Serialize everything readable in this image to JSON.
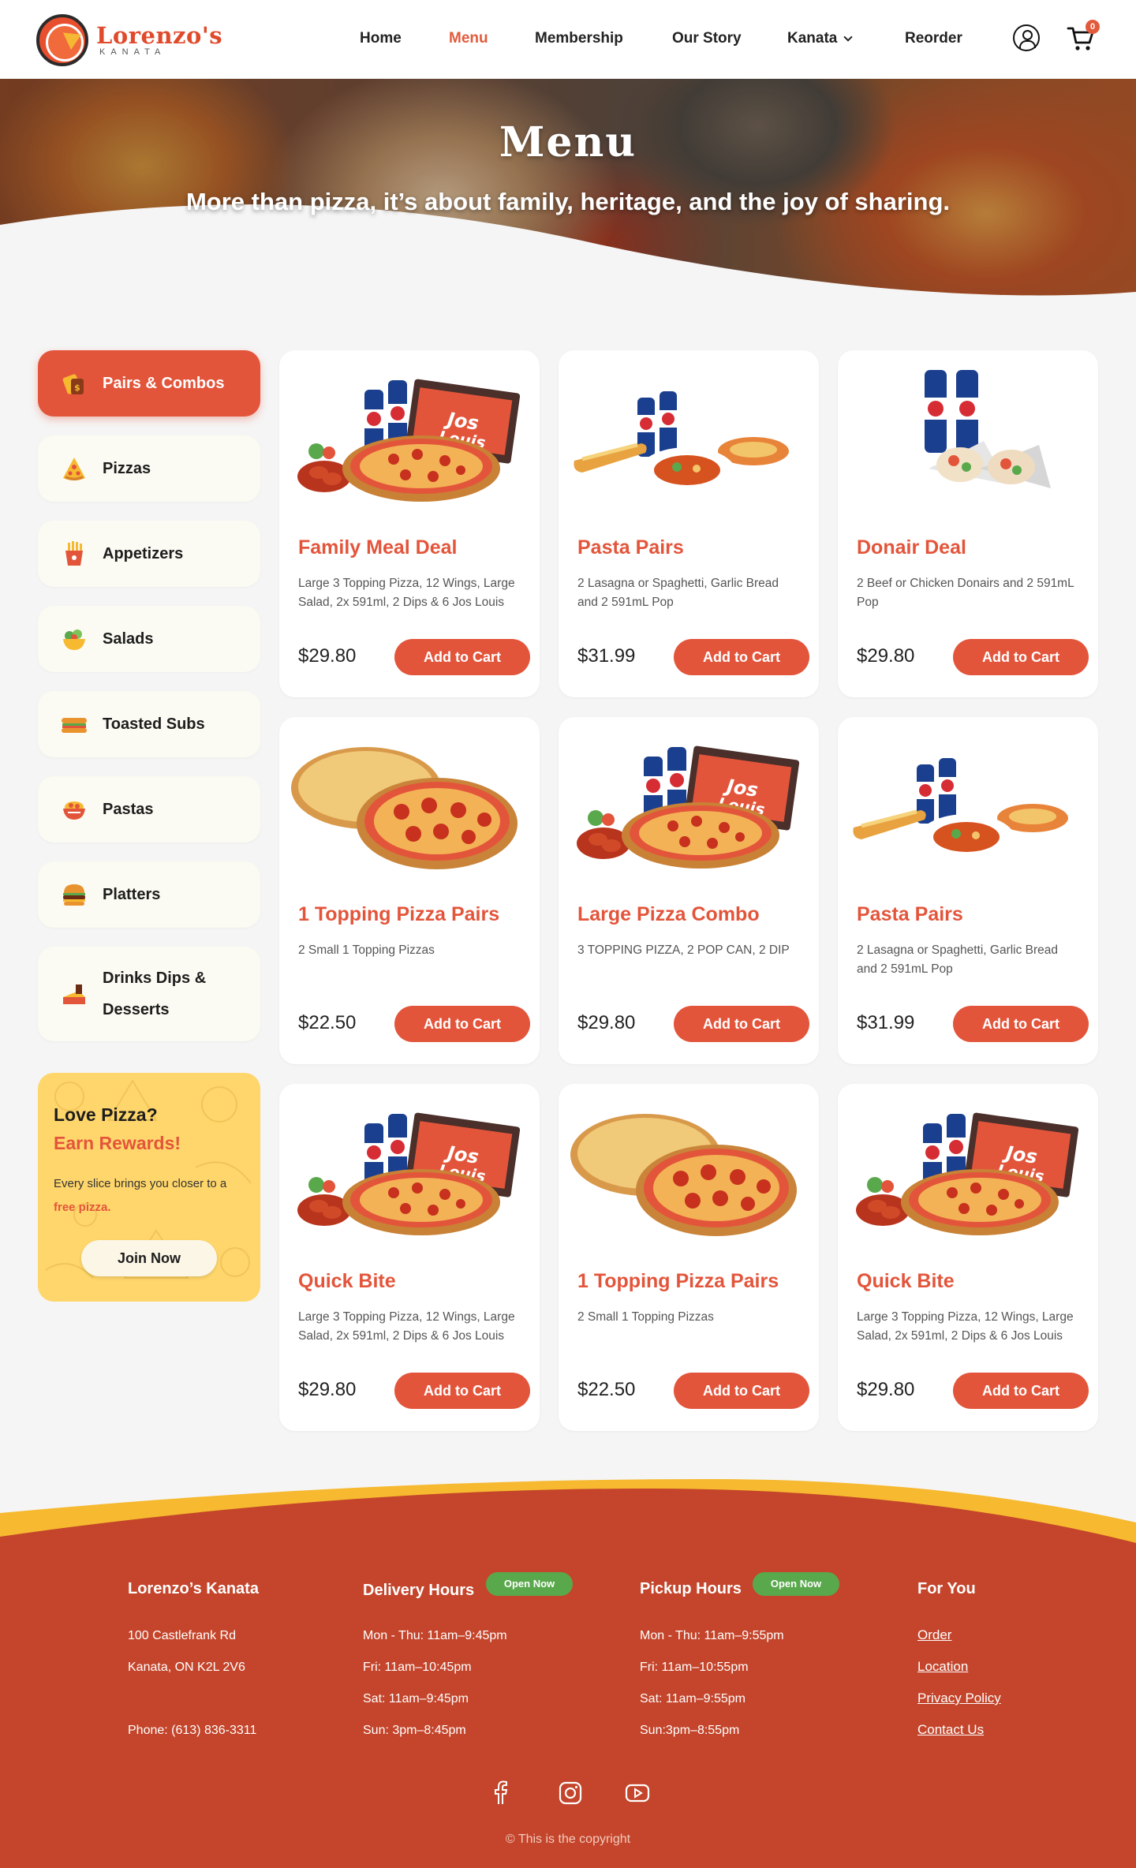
{
  "brand": {
    "name": "Lorenzo's",
    "sub": "KANATA"
  },
  "nav": {
    "home": "Home",
    "menu": "Menu",
    "membership": "Membership",
    "story": "Our Story",
    "location": "Kanata",
    "reorder": "Reorder",
    "cart_count": "0"
  },
  "hero": {
    "title": "Menu",
    "subtitle": "More than pizza, it’s about family, heritage, and the joy of sharing."
  },
  "categories": [
    {
      "label": "Pairs & Combos",
      "active": true
    },
    {
      "label": "Pizzas"
    },
    {
      "label": "Appetizers"
    },
    {
      "label": "Salads"
    },
    {
      "label": "Toasted Subs"
    },
    {
      "label": "Pastas"
    },
    {
      "label": "Platters"
    },
    {
      "label": "Drinks Dips & Desserts"
    }
  ],
  "promo": {
    "line1": "Love Pizza?",
    "line2": "Earn Rewards!",
    "text": "Every slice brings you closer to a",
    "highlight": "free pizza.",
    "button": "Join Now"
  },
  "cards": [
    {
      "title": "Family Meal Deal",
      "desc": "Large 3 Topping Pizza, 12 Wings, Large Salad, 2x 591ml, 2 Dips & 6 Jos Louis",
      "price": "$29.80",
      "button": "Add to Cart",
      "image": "family-combo"
    },
    {
      "title": "Pasta Pairs",
      "desc": "2 Lasagna or Spaghetti, Garlic Bread and 2 591mL Pop",
      "price": "$31.99",
      "button": "Add to Cart",
      "image": "pasta"
    },
    {
      "title": "Donair Deal",
      "desc": "2 Beef or Chicken Donairs and 2 591mL Pop",
      "price": "$29.80",
      "button": "Add to Cart",
      "image": "donair"
    },
    {
      "title": "1 Topping Pizza Pairs",
      "desc": "2 Small 1 Topping Pizzas",
      "price": "$22.50",
      "button": "Add to Cart",
      "image": "two-pizzas"
    },
    {
      "title": "Large Pizza Combo",
      "desc": "3 TOPPING PIZZA, 2 POP CAN, 2 DIP",
      "price": "$29.80",
      "button": "Add to Cart",
      "image": "family-combo"
    },
    {
      "title": "Pasta Pairs",
      "desc": "2 Lasagna or Spaghetti, Garlic Bread and 2 591mL Pop",
      "price": "$31.99",
      "button": "Add to Cart",
      "image": "pasta"
    },
    {
      "title": "Quick Bite",
      "desc": "Large 3 Topping Pizza, 12 Wings, Large Salad, 2x 591ml, 2 Dips & 6 Jos Louis",
      "price": "$29.80",
      "button": "Add to Cart",
      "image": "family-combo"
    },
    {
      "title": "1 Topping Pizza Pairs",
      "desc": "2 Small 1 Topping Pizzas",
      "price": "$22.50",
      "button": "Add to Cart",
      "image": "two-pizzas"
    },
    {
      "title": "Quick Bite",
      "desc": "Large 3 Topping Pizza, 12 Wings, Large Salad, 2x 591ml, 2 Dips & 6 Jos Louis",
      "price": "$29.80",
      "button": "Add to Cart",
      "image": "family-combo"
    }
  ],
  "footer": {
    "store": {
      "title": "Lorenzo’s Kanata",
      "address1": "100 Castlefrank Rd",
      "address2": "Kanata, ON K2L 2V6",
      "phone": "Phone: (613) 836-3311"
    },
    "delivery": {
      "title": "Delivery Hours",
      "badge": "Open Now",
      "hours": [
        "Mon - Thu: 11am–9:45pm",
        "Fri: 11am–10:45pm",
        "Sat: 11am–9:45pm",
        "Sun: 3pm–8:45pm"
      ]
    },
    "pickup": {
      "title": "Pickup Hours",
      "badge": "Open Now",
      "hours": [
        "Mon - Thu: 11am–9:55pm",
        "Fri: 11am–10:55pm",
        "Sat: 11am–9:55pm",
        "Sun:3pm–8:55pm"
      ]
    },
    "foryou": {
      "title": "For You",
      "links": [
        "Order",
        "Location",
        "Privacy Policy",
        "Contact Us"
      ]
    },
    "copyright": "© This is the copyright"
  },
  "colors": {
    "accent": "#e3553b",
    "footer": "#c4452b",
    "promo": "#ffd66b",
    "open_badge": "#5aa84c",
    "wave": "#f6b930"
  }
}
